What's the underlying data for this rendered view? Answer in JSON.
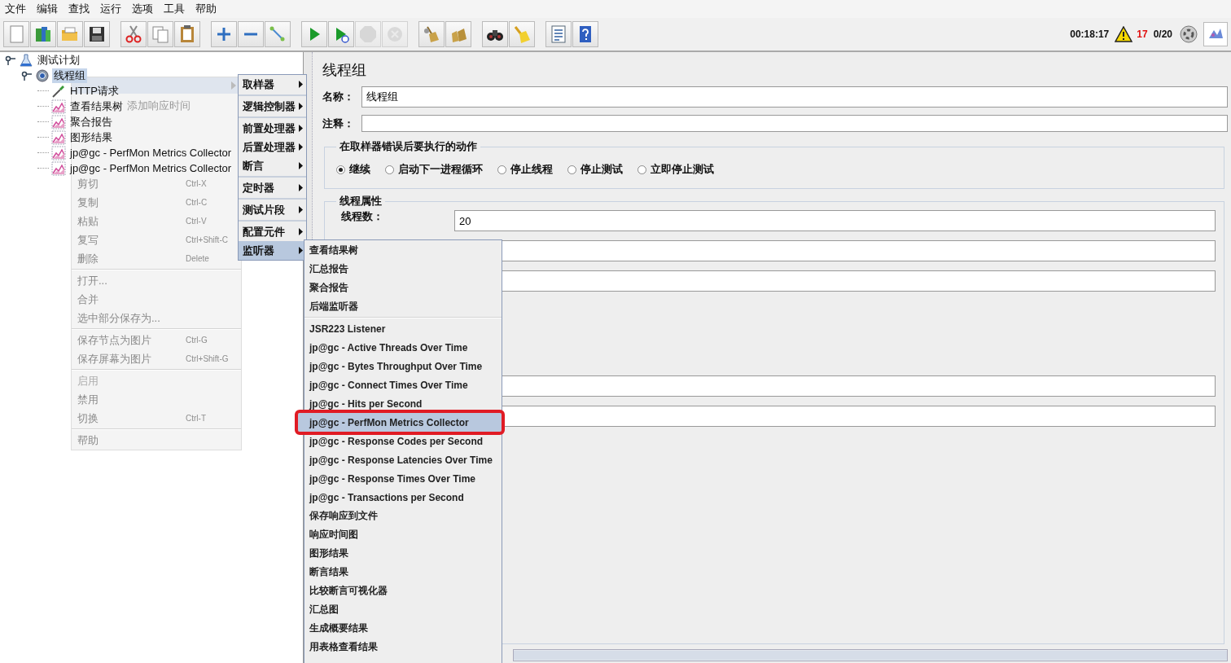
{
  "menu_bar": [
    "文件",
    "编辑",
    "查找",
    "运行",
    "选项",
    "工具",
    "帮助"
  ],
  "toolbar": [
    {
      "kind": "new",
      "disabled": false
    },
    {
      "kind": "templates",
      "disabled": false
    },
    {
      "kind": "open",
      "disabled": false
    },
    {
      "kind": "save",
      "disabled": false
    },
    {
      "kind": "gap"
    },
    {
      "kind": "cut",
      "disabled": false
    },
    {
      "kind": "copy",
      "disabled": false
    },
    {
      "kind": "paste",
      "disabled": false
    },
    {
      "kind": "gap"
    },
    {
      "kind": "expand",
      "disabled": false
    },
    {
      "kind": "collapse",
      "disabled": false
    },
    {
      "kind": "toggle",
      "disabled": false
    },
    {
      "kind": "gap"
    },
    {
      "kind": "start",
      "disabled": false
    },
    {
      "kind": "start_no_pause",
      "disabled": false
    },
    {
      "kind": "stop",
      "disabled": true
    },
    {
      "kind": "shutdown",
      "disabled": true
    },
    {
      "kind": "gap"
    },
    {
      "kind": "clear",
      "disabled": false
    },
    {
      "kind": "clear_all",
      "disabled": false
    },
    {
      "kind": "gap"
    },
    {
      "kind": "search",
      "disabled": false
    },
    {
      "kind": "reset_search",
      "disabled": false
    },
    {
      "kind": "gap"
    },
    {
      "kind": "function_helper",
      "disabled": false
    },
    {
      "kind": "help",
      "disabled": false
    }
  ],
  "status": {
    "elapsed": "00:18:17",
    "error_count": "17",
    "threads": "0/20"
  },
  "tree": [
    {
      "label": "测试计划",
      "kind": "plan",
      "selected": false,
      "expanded": true,
      "children": [
        {
          "label": "线程组",
          "kind": "thread_group",
          "selected": true,
          "expanded": true,
          "children": [
            {
              "label": "HTTP请求",
              "kind": "sampler",
              "selected": false
            },
            {
              "label": "查看结果树",
              "kind": "listener",
              "selected": false
            },
            {
              "label": "聚合报告",
              "kind": "listener",
              "selected": false
            },
            {
              "label": "图形结果",
              "kind": "listener",
              "selected": false
            },
            {
              "label": "jp@gc - PerfMon Metrics Collector",
              "kind": "listener",
              "selected": false
            },
            {
              "label": "jp@gc - PerfMon Metrics Collector",
              "kind": "listener",
              "selected": false
            }
          ]
        }
      ]
    }
  ],
  "context_menu": {
    "top_items": [
      {
        "kind": "submenu",
        "selected": true
      },
      {
        "kind": "item",
        "label": "添加响应时间",
        "disabled": true
      }
    ],
    "items": [
      {
        "kind": "item",
        "label": "剪切",
        "shortcut": "Ctrl-X",
        "disabled": false
      },
      {
        "kind": "item",
        "label": "复制",
        "shortcut": "Ctrl-C",
        "disabled": false
      },
      {
        "kind": "item",
        "label": "粘贴",
        "shortcut": "Ctrl-V",
        "disabled": false
      },
      {
        "kind": "item",
        "label": "复写",
        "shortcut": "Ctrl+Shift-C",
        "disabled": false
      },
      {
        "kind": "item",
        "label": "删除",
        "shortcut": "Delete",
        "disabled": false
      },
      {
        "kind": "separator"
      },
      {
        "kind": "item",
        "label": "打开...",
        "disabled": false
      },
      {
        "kind": "item",
        "label": "合并",
        "disabled": false
      },
      {
        "kind": "item",
        "label": "选中部分保存为...",
        "disabled": false
      },
      {
        "kind": "separator"
      },
      {
        "kind": "item",
        "label": "保存节点为图片",
        "shortcut": "Ctrl-G",
        "disabled": false
      },
      {
        "kind": "item",
        "label": "保存屏幕为图片",
        "shortcut": "Ctrl+Shift-G",
        "disabled": false
      },
      {
        "kind": "separator"
      },
      {
        "kind": "item",
        "label": "启用",
        "disabled": true
      },
      {
        "kind": "item",
        "label": "禁用",
        "disabled": false
      },
      {
        "kind": "item",
        "label": "切换",
        "shortcut": "Ctrl-T",
        "disabled": false
      },
      {
        "kind": "separator"
      },
      {
        "kind": "item",
        "label": "帮助",
        "disabled": false
      }
    ]
  },
  "category_menu": [
    {
      "kind": "submenu",
      "label": "取样器",
      "selected": false
    },
    {
      "kind": "separator"
    },
    {
      "kind": "submenu",
      "label": "逻辑控制器",
      "selected": false
    },
    {
      "kind": "separator"
    },
    {
      "kind": "submenu",
      "label": "前置处理器",
      "selected": false
    },
    {
      "kind": "submenu",
      "label": "后置处理器",
      "selected": false
    },
    {
      "kind": "submenu",
      "label": "断言",
      "selected": false
    },
    {
      "kind": "separator"
    },
    {
      "kind": "submenu",
      "label": "定时器",
      "selected": false
    },
    {
      "kind": "separator"
    },
    {
      "kind": "submenu",
      "label": "测试片段",
      "selected": false
    },
    {
      "kind": "separator"
    },
    {
      "kind": "submenu",
      "label": "配置元件",
      "selected": false
    },
    {
      "kind": "submenu",
      "label": "监听器",
      "selected": true
    }
  ],
  "listener_menu": [
    {
      "kind": "item",
      "label": "查看结果树",
      "selected": false,
      "annotated": false
    },
    {
      "kind": "item",
      "label": "汇总报告",
      "selected": false,
      "annotated": false
    },
    {
      "kind": "item",
      "label": "聚合报告",
      "selected": false,
      "annotated": false
    },
    {
      "kind": "item",
      "label": "后端监听器",
      "selected": false,
      "annotated": false
    },
    {
      "kind": "separator"
    },
    {
      "kind": "item",
      "label": "JSR223 Listener",
      "selected": false,
      "annotated": false
    },
    {
      "kind": "item",
      "label": "jp@gc - Active Threads Over Time",
      "selected": false,
      "annotated": false
    },
    {
      "kind": "item",
      "label": "jp@gc - Bytes Throughput Over Time",
      "selected": false,
      "annotated": false
    },
    {
      "kind": "item",
      "label": "jp@gc - Connect Times Over Time",
      "selected": false,
      "annotated": false
    },
    {
      "kind": "item",
      "label": "jp@gc - Hits per Second",
      "selected": false,
      "annotated": false
    },
    {
      "kind": "item",
      "label": "jp@gc - PerfMon Metrics Collector",
      "selected": true,
      "annotated": true
    },
    {
      "kind": "item",
      "label": "jp@gc - Response Codes per Second",
      "selected": false,
      "annotated": false
    },
    {
      "kind": "item",
      "label": "jp@gc - Response Latencies Over Time",
      "selected": false,
      "annotated": false
    },
    {
      "kind": "item",
      "label": "jp@gc - Response Times Over Time",
      "selected": false,
      "annotated": false
    },
    {
      "kind": "item",
      "label": "jp@gc - Transactions per Second",
      "selected": false,
      "annotated": false
    },
    {
      "kind": "item",
      "label": "保存响应到文件",
      "selected": false,
      "annotated": false
    },
    {
      "kind": "item",
      "label": "响应时间图",
      "selected": false,
      "annotated": false
    },
    {
      "kind": "item",
      "label": "图形结果",
      "selected": false,
      "annotated": false
    },
    {
      "kind": "item",
      "label": "断言结果",
      "selected": false,
      "annotated": false
    },
    {
      "kind": "item",
      "label": "比较断言可视化器",
      "selected": false,
      "annotated": false
    },
    {
      "kind": "item",
      "label": "汇总图",
      "selected": false,
      "annotated": false
    },
    {
      "kind": "item",
      "label": "生成概要结果",
      "selected": false,
      "annotated": false
    },
    {
      "kind": "item",
      "label": "用表格查看结果",
      "selected": false,
      "annotated": false
    }
  ],
  "panel": {
    "title": "线程组",
    "name_field": {
      "label": "名称：",
      "value": "线程组"
    },
    "comment_field": {
      "label": "注释："
    },
    "on_error": {
      "title": "在取样器错误后要执行的动作",
      "options": [
        {
          "label": "继续",
          "selected": true
        },
        {
          "label": "启动下一进程循环",
          "selected": false
        },
        {
          "label": "停止线程",
          "selected": false
        },
        {
          "label": "停止测试",
          "selected": false
        },
        {
          "label": "立即停止测试",
          "selected": false
        }
      ]
    },
    "thread_props": {
      "title": "线程属性",
      "threads": {
        "label": "线程数：",
        "value": "20"
      }
    }
  }
}
